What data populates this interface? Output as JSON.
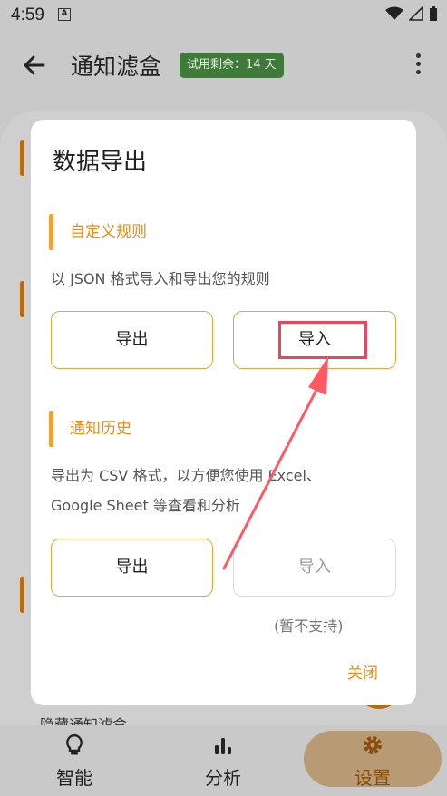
{
  "status_bar": {
    "time": "4:59",
    "notif_icon": "A"
  },
  "app_bar": {
    "title": "通知滤盒",
    "trial_badge": "试用剩余：14 天"
  },
  "background": {
    "hidden_item_label": "隐藏通知滤盒"
  },
  "dialog": {
    "title": "数据导出",
    "custom_rules": {
      "heading": "自定义规则",
      "description": "以 JSON 格式导入和导出您的规则",
      "export_label": "导出",
      "import_label": "导入"
    },
    "notification_history": {
      "heading": "通知历史",
      "description_line1": "导出为 CSV 格式，以方便您使用 Excel、",
      "description_line2": "Google Sheet 等查看和分析",
      "export_label": "导出",
      "import_label": "导入",
      "unsupported_note": "(暂不支持)"
    },
    "close_label": "关闭"
  },
  "bottom_nav": {
    "items": [
      {
        "label": "智能",
        "icon": "lightbulb-icon"
      },
      {
        "label": "分析",
        "icon": "bar-chart-icon"
      },
      {
        "label": "设置",
        "icon": "gear-icon",
        "active": true
      }
    ]
  },
  "colors": {
    "accent": "#f0a23a",
    "accent_text": "#ec8e16",
    "highlight": "#e8485b",
    "trial_badge": "#3f7a3a"
  }
}
